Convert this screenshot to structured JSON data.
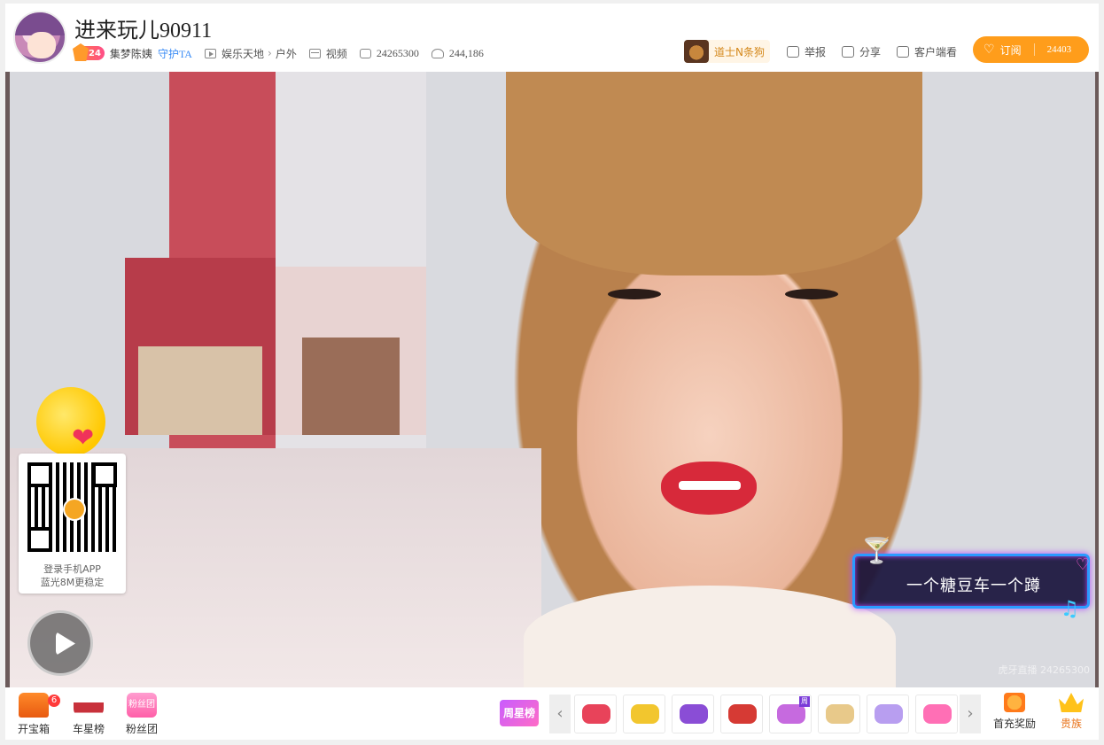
{
  "header": {
    "title": "进来玩儿90911",
    "level": "24",
    "anchor_name": "集梦陈姨",
    "guard_label": "守护TA",
    "category": "娱乐天地",
    "subcategory": "户外",
    "video_label": "视频",
    "room_id": "24265300",
    "viewers": "244,186",
    "pet_label": "道士N条狗",
    "report_label": "举报",
    "share_label": "分享",
    "client_label": "客户端看",
    "subscribe_label": "订阅",
    "subscribe_count": "24403"
  },
  "video": {
    "qr_line1": "登录手机APP",
    "qr_line2": "蓝光8M更稳定",
    "neon_text": "一个糖豆车一个蹲",
    "watermark": "虎牙直播 24265300"
  },
  "bottom": {
    "treasure_label": "开宝箱",
    "treasure_count": "6",
    "car_rank_label": "车星榜",
    "fans_label": "粉丝团",
    "fans_icon_text": "粉丝团",
    "weekly_star_label": "周星榜",
    "gift_tag": "周",
    "first_charge_label": "首充奖励",
    "noble_label": "贵族"
  },
  "gifts": [
    {
      "color": "#e8435a"
    },
    {
      "color": "#f2c62e"
    },
    {
      "color": "#8a4dd6"
    },
    {
      "color": "#d63a34"
    },
    {
      "color": "#c66adf"
    },
    {
      "color": "#e8c98a"
    },
    {
      "color": "#b89ef0"
    },
    {
      "color": "#ff6fb5"
    }
  ]
}
